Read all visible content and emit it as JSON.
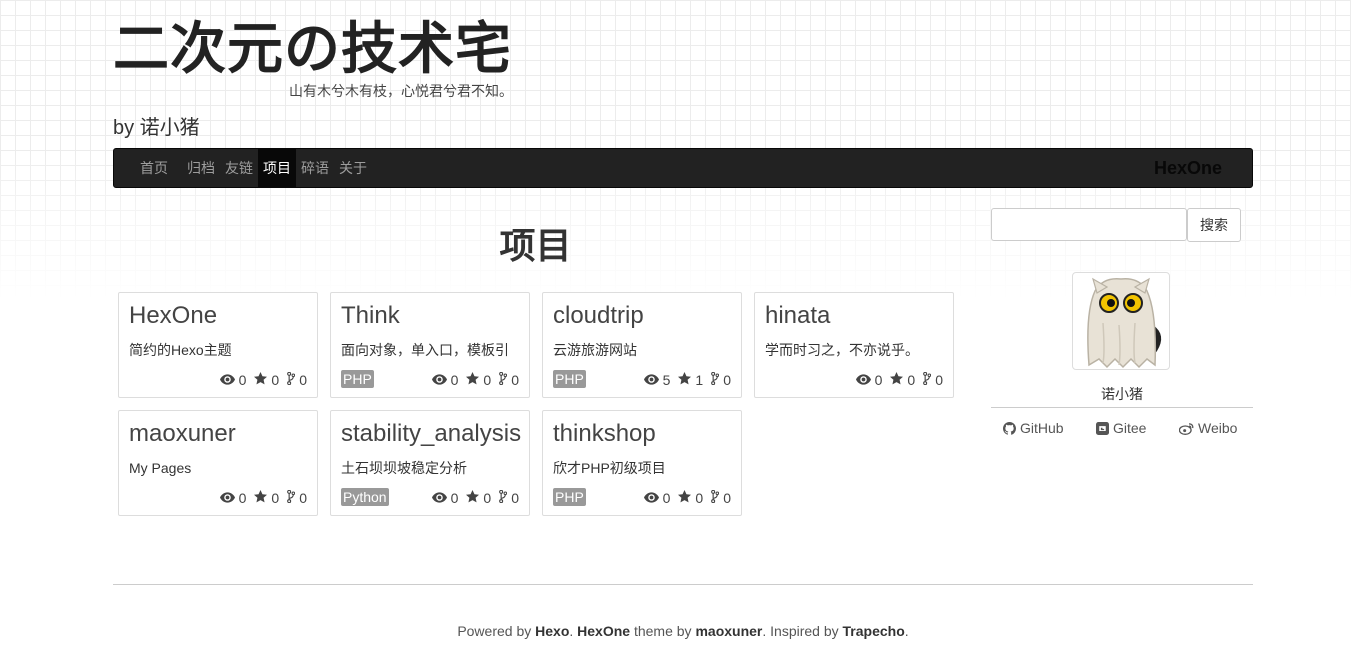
{
  "header": {
    "title": "二次元の技术宅",
    "subtitle": "山有木兮木有枝，心悦君兮君不知。",
    "author": "by 诺小猪"
  },
  "navbar": {
    "items": [
      {
        "label": "首页",
        "active": false
      },
      {
        "label": "归档",
        "active": false
      },
      {
        "label": "友链",
        "active": false
      },
      {
        "label": "项目",
        "active": true
      },
      {
        "label": "碎语",
        "active": false
      },
      {
        "label": "关于",
        "active": false
      }
    ],
    "brand": "HexOne"
  },
  "main": {
    "heading": "项目",
    "projects": [
      {
        "name": "HexOne",
        "desc": "简约的Hexo主题",
        "lang": "",
        "watchers": "0",
        "stars": "0",
        "forks": "0"
      },
      {
        "name": "Think",
        "desc": "面向对象，单入口，模板引",
        "lang": "PHP",
        "watchers": "0",
        "stars": "0",
        "forks": "0"
      },
      {
        "name": "cloudtrip",
        "desc": "云游旅游网站",
        "lang": "PHP",
        "watchers": "5",
        "stars": "1",
        "forks": "0"
      },
      {
        "name": "hinata",
        "desc": "学而时习之，不亦说乎。",
        "lang": "",
        "watchers": "0",
        "stars": "0",
        "forks": "0"
      },
      {
        "name": "maoxuner",
        "desc": "My Pages",
        "lang": "",
        "watchers": "0",
        "stars": "0",
        "forks": "0"
      },
      {
        "name": "stability_analysis",
        "desc": "土石坝坝坡稳定分析",
        "lang": "Python",
        "watchers": "0",
        "stars": "0",
        "forks": "0"
      },
      {
        "name": "thinkshop",
        "desc": "欣才PHP初级项目",
        "lang": "PHP",
        "watchers": "0",
        "stars": "0",
        "forks": "0"
      }
    ]
  },
  "sidebar": {
    "search_placeholder": "",
    "search_button": "搜索",
    "profile_name": "诺小猪",
    "links": [
      {
        "label": "GitHub",
        "icon": "github-icon"
      },
      {
        "label": "Gitee",
        "icon": "gitee-icon"
      },
      {
        "label": "Weibo",
        "icon": "weibo-icon"
      }
    ]
  },
  "footer": {
    "powered_by": "Powered by ",
    "hexo": "Hexo",
    "sep1": ". ",
    "hexone": "HexOne",
    "theme_by": " theme by ",
    "maoxuner": "maoxuner",
    "inspired": ". Inspired by ",
    "trapecho": "Trapecho",
    "end": "."
  },
  "colors": {
    "navbar_bg": "#222222",
    "nav_active_bg": "#080808",
    "lang_badge": "#999999"
  }
}
